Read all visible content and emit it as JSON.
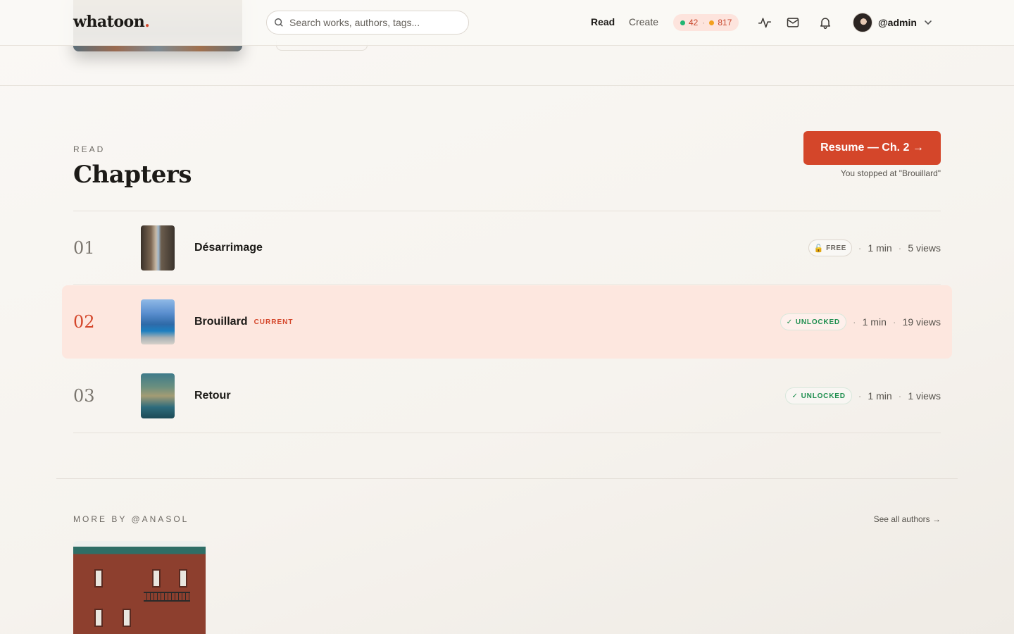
{
  "header": {
    "logo_text": "whatoon",
    "logo_dot": ".",
    "search_placeholder": "Search works, authors, tags...",
    "nav": [
      {
        "label": "Read",
        "active": true
      },
      {
        "label": "Create",
        "active": false
      }
    ],
    "stats": {
      "green_count": "42",
      "separator": "·",
      "orange_count": "817"
    },
    "icons": [
      "activity-icon",
      "mail-icon",
      "bell-icon"
    ],
    "user": {
      "handle": "@admin"
    }
  },
  "chapters_section": {
    "eyebrow": "READ",
    "title": "Chapters",
    "resume_label": "Resume — Ch. 2 →",
    "resume_note": "You stopped at \"Brouillard\"",
    "items": [
      {
        "number": "01",
        "title": "Désarrimage",
        "badge": "FREE",
        "badge_type": "free",
        "duration": "1 min",
        "views": "5 views",
        "current": false
      },
      {
        "number": "02",
        "title": "Brouillard",
        "current_label": "CURRENT",
        "badge": "UNLOCKED",
        "badge_type": "unlocked",
        "duration": "1 min",
        "views": "19 views",
        "current": true
      },
      {
        "number": "03",
        "title": "Retour",
        "badge": "UNLOCKED",
        "badge_type": "unlocked",
        "duration": "1 min",
        "views": "1 views",
        "current": false
      }
    ],
    "meta_separator": "·"
  },
  "more_section": {
    "eyebrow": "MORE BY @ANASOL",
    "see_all": "See all authors →"
  },
  "colors": {
    "accent": "#d4462a",
    "current_row_bg": "#fde7df",
    "unlocked_green": "#1e8e4f",
    "background": "#faf8f5"
  }
}
